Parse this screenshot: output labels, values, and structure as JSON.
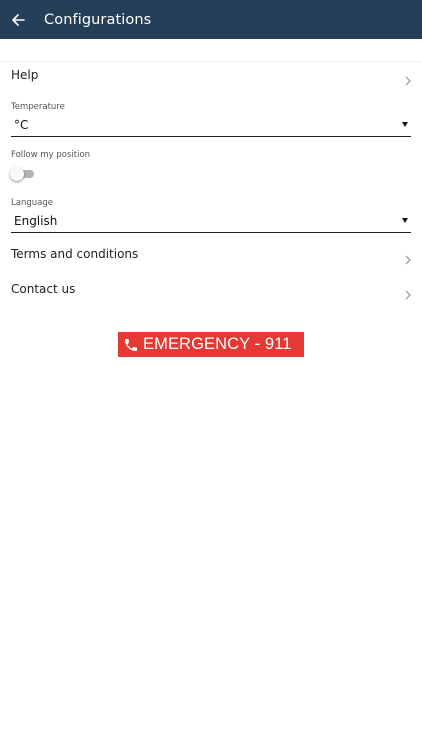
{
  "appbar": {
    "title": "Configurations",
    "back_icon": "arrow-left-icon",
    "background": "#263f59"
  },
  "settings": {
    "help_label": "Help",
    "temperature": {
      "label": "Temperature",
      "value": "°C"
    },
    "follow_position": {
      "label": "Follow my position",
      "enabled": false
    },
    "language": {
      "label": "Language",
      "value": "English"
    },
    "terms_label": "Terms and conditions",
    "contact_label": "Contact us"
  },
  "emergency": {
    "label": "EMERGENCY - 911",
    "icon": "phone-icon",
    "color": "#e53935"
  }
}
